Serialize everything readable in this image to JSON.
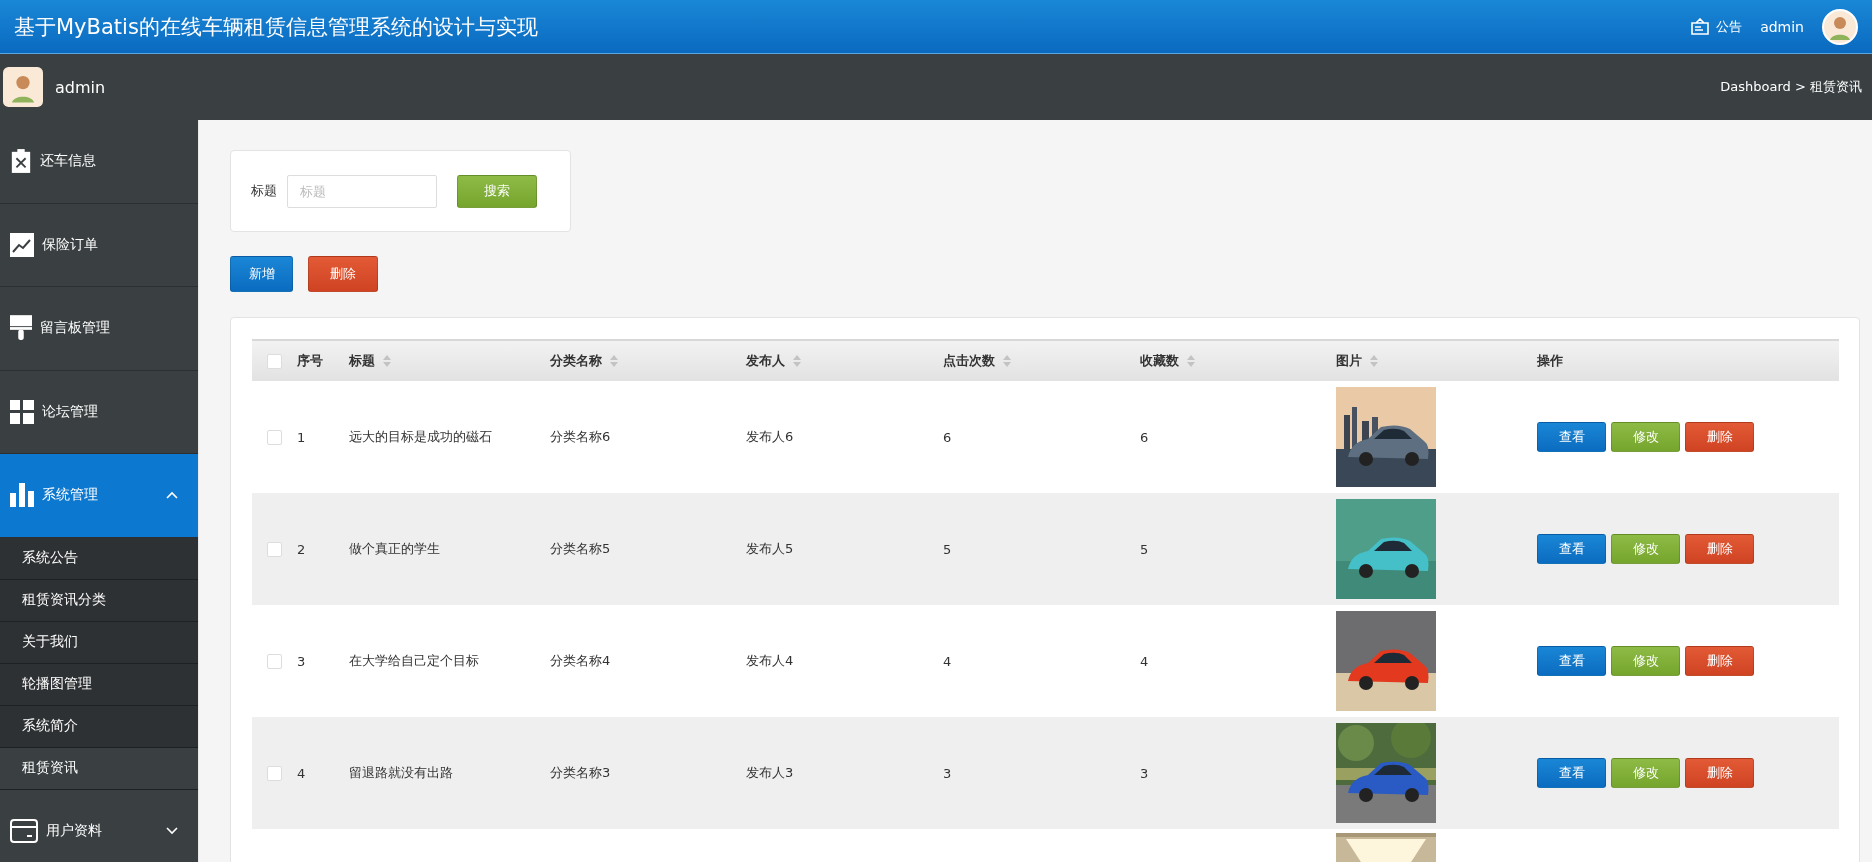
{
  "header": {
    "title": "基于MyBatis的在线车辆租赁信息管理系统的设计与实现",
    "notice": "公告",
    "user": "admin"
  },
  "subbar": {
    "user": "admin",
    "breadcrumb": "Dashboard > 租赁资讯"
  },
  "sidebar": {
    "items": [
      {
        "label": "还车信息",
        "selected": false
      },
      {
        "label": "保险订单",
        "selected": false
      },
      {
        "label": "留言板管理",
        "selected": false
      },
      {
        "label": "论坛管理",
        "selected": false
      },
      {
        "label": "系统管理",
        "expanded": true,
        "selected": true,
        "children": [
          {
            "label": "系统公告",
            "selected": false
          },
          {
            "label": "租赁资讯分类",
            "selected": false
          },
          {
            "label": "关于我们",
            "selected": false
          },
          {
            "label": "轮播图管理",
            "selected": false
          },
          {
            "label": "系统简介",
            "selected": false
          },
          {
            "label": "租赁资讯",
            "selected": true
          }
        ]
      },
      {
        "label": "用户资料",
        "expanded": false,
        "selected": false
      }
    ]
  },
  "search": {
    "label": "标题",
    "placeholder": "标题",
    "button": "搜索"
  },
  "actions": {
    "add": "新增",
    "delete": "删除"
  },
  "table": {
    "select_all": false,
    "columns": [
      {
        "label": "序号",
        "sortable": false
      },
      {
        "label": "标题",
        "sortable": true
      },
      {
        "label": "分类名称",
        "sortable": true
      },
      {
        "label": "发布人",
        "sortable": true
      },
      {
        "label": "点击次数",
        "sortable": true
      },
      {
        "label": "收藏数",
        "sortable": true
      },
      {
        "label": "图片",
        "sortable": true
      },
      {
        "label": "操作",
        "sortable": false
      }
    ],
    "rows": [
      {
        "checked": false,
        "index": "1",
        "title": "远大的目标是成功的磁石",
        "category": "分类名称6",
        "publisher": "发布人6",
        "clicks": "6",
        "favorites": "6",
        "buttons": {
          "view": "查看",
          "edit": "修改",
          "delete": "删除"
        }
      },
      {
        "checked": false,
        "index": "2",
        "title": "做个真正的学生",
        "category": "分类名称5",
        "publisher": "发布人5",
        "clicks": "5",
        "favorites": "5",
        "buttons": {
          "view": "查看",
          "edit": "修改",
          "delete": "删除"
        }
      },
      {
        "checked": false,
        "index": "3",
        "title": "在大学给自己定个目标",
        "category": "分类名称4",
        "publisher": "发布人4",
        "clicks": "4",
        "favorites": "4",
        "buttons": {
          "view": "查看",
          "edit": "修改",
          "delete": "删除"
        }
      },
      {
        "checked": false,
        "index": "4",
        "title": "留退路就没有出路",
        "category": "分类名称3",
        "publisher": "发布人3",
        "clicks": "3",
        "favorites": "3",
        "buttons": {
          "view": "查看",
          "edit": "修改",
          "delete": "删除"
        }
      }
    ],
    "more_rows": true
  }
}
